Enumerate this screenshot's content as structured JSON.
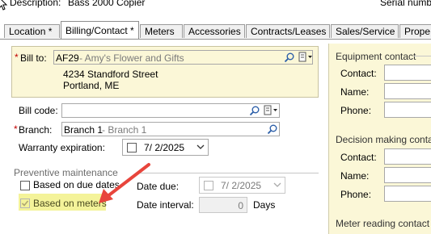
{
  "top": {
    "description_label": "Description:",
    "description_value": "Bass 2000 Copier",
    "serial_label": "Serial numbe"
  },
  "tabs": [
    {
      "label": "Location *",
      "active": false
    },
    {
      "label": "Billing/Contact *",
      "active": true
    },
    {
      "label": "Meters",
      "active": false
    },
    {
      "label": "Accessories",
      "active": false
    },
    {
      "label": "Contracts/Leases",
      "active": false
    },
    {
      "label": "Sales/Service",
      "active": false
    },
    {
      "label": "Prope",
      "active": false
    }
  ],
  "bill_to": {
    "required_mark": "*",
    "label": "Bill to:",
    "code": "AF29",
    "name": " - Amy's Flower and Gifts",
    "address_line1": "4234 Standford Street",
    "address_line2": "Portland, ME"
  },
  "bill_code": {
    "label": "Bill code:",
    "value": ""
  },
  "branch": {
    "required_mark": "*",
    "label": "Branch:",
    "value": "Branch 1",
    "desc": " - Branch 1"
  },
  "warranty": {
    "label": "Warranty expiration:",
    "value": "7/ 2/2025",
    "checked": false
  },
  "preventive": {
    "title": "Preventive maintenance",
    "based_on_due_dates": {
      "label": "Based on due dates",
      "checked": false
    },
    "based_on_meters": {
      "label": "Based on meters",
      "checked": true
    },
    "date_due": {
      "label": "Date due:",
      "value": "7/ 2/2025"
    },
    "date_interval": {
      "label": "Date interval:",
      "value": "0",
      "unit": "Days"
    }
  },
  "right_panel": {
    "equipment_contact": {
      "title": "Equipment contact",
      "contact": "Contact:",
      "name": "Name:",
      "phone": "Phone:"
    },
    "decision_contact": {
      "title": "Decision making contact",
      "contact": "Contact:",
      "name": "Name:",
      "phone": "Phone:"
    },
    "meter_contact": {
      "title": "Meter reading contact"
    }
  },
  "colors": {
    "highlight": "#f4f39a",
    "arrow": "#e8453c",
    "panel_yellow": "#fbf7d7",
    "required": "#c00000"
  }
}
